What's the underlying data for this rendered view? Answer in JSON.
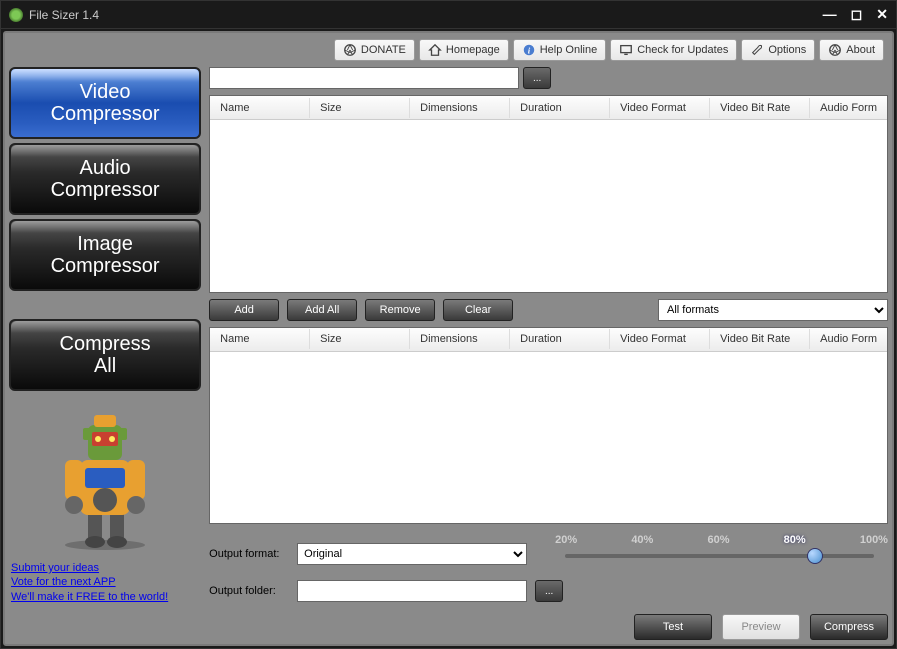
{
  "window": {
    "title": "File Sizer 1.4"
  },
  "menu": {
    "donate": "DONATE",
    "homepage": "Homepage",
    "help": "Help Online",
    "updates": "Check for Updates",
    "options": "Options",
    "about": "About"
  },
  "sidebar": {
    "video": "Video Compressor",
    "audio": "Audio Compressor",
    "image": "Image Compressor",
    "all": "Compress All"
  },
  "links": {
    "submit": "Submit your ideas",
    "vote": "Vote for the next APP",
    "free": "We'll make it FREE to the world!"
  },
  "path_input": "",
  "table": {
    "cols": {
      "name": "Name",
      "size": "Size",
      "dimensions": "Dimensions",
      "duration": "Duration",
      "vformat": "Video Format",
      "vbitrate": "Video Bit Rate",
      "aformat": "Audio Form"
    }
  },
  "actions": {
    "add": "Add",
    "addall": "Add All",
    "remove": "Remove",
    "clear": "Clear",
    "format_filter": "All formats"
  },
  "output": {
    "format_label": "Output format:",
    "format_value": "Original",
    "folder_label": "Output folder:",
    "folder_value": ""
  },
  "slider": {
    "ticks": [
      "20%",
      "40%",
      "60%",
      "80%",
      "100%"
    ],
    "value": 80
  },
  "bottom": {
    "test": "Test",
    "preview": "Preview",
    "compress": "Compress"
  },
  "browse_label": "..."
}
